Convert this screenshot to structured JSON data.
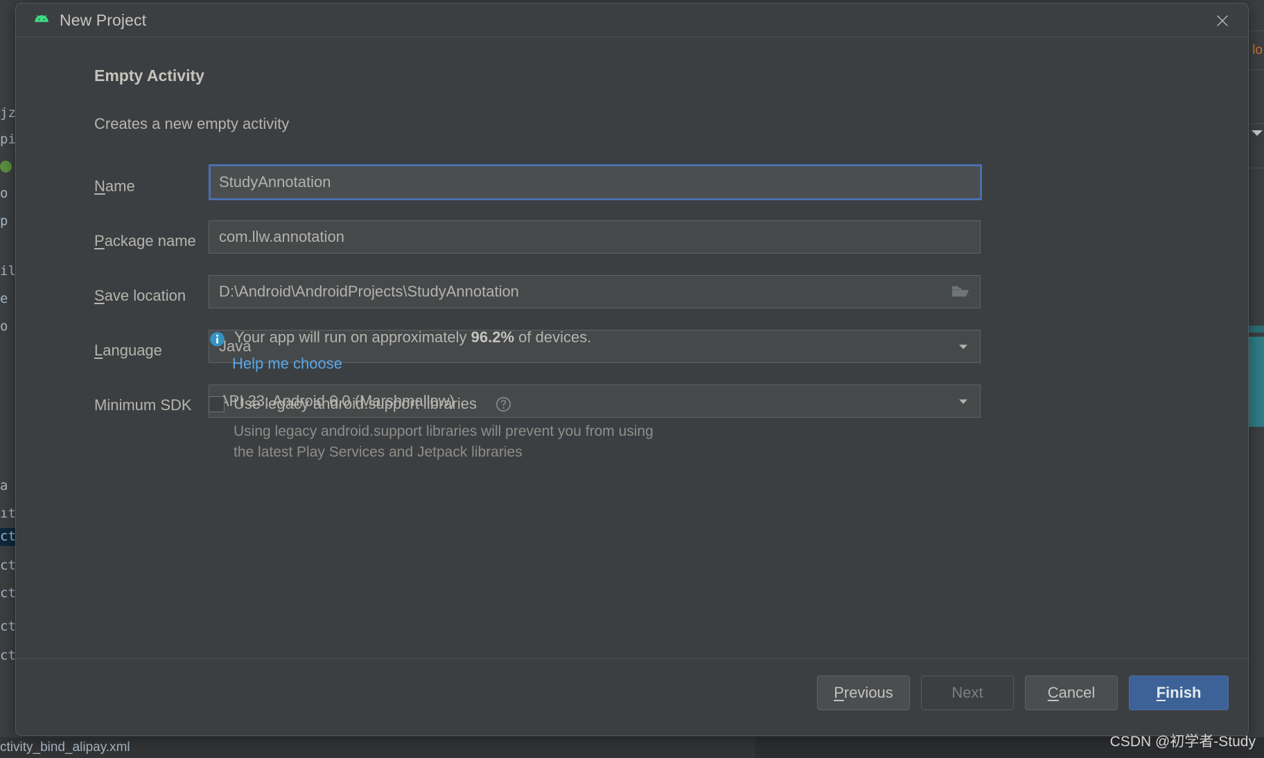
{
  "window": {
    "title": "New Project",
    "app_icon": "android-robot-icon",
    "close_icon": "close-icon"
  },
  "dialog": {
    "heading": "Empty Activity",
    "subheading": "Creates a new empty activity",
    "fields": [
      {
        "label": "Name",
        "mnemonic": "N",
        "value": "StudyAnnotation",
        "type": "text",
        "focused": true
      },
      {
        "label": "Package name",
        "mnemonic": "P",
        "value": "com.llw.annotation",
        "type": "text",
        "focused": false
      },
      {
        "label": "Save location",
        "mnemonic": "S",
        "value": "D:\\Android\\AndroidProjects\\StudyAnnotation",
        "type": "path",
        "trailing_icon": "folder-icon",
        "focused": false
      },
      {
        "label": "Language",
        "mnemonic": "L",
        "value": "Java",
        "type": "dropdown",
        "trailing_icon": "chevron-down-icon",
        "focused": false
      },
      {
        "label": "Minimum SDK",
        "mnemonic": "",
        "value": "API 23: Android 6.0 (Marshmallow)",
        "type": "dropdown",
        "trailing_icon": "chevron-down-icon",
        "focused": false
      }
    ],
    "info": {
      "icon": "info-icon",
      "text_before": "Your app will run on approximately",
      "highlight": "96.2%",
      "text_after": "of devices.",
      "link": "Help me choose"
    },
    "legacy_checkbox": {
      "checked": false,
      "label": "Use legacy android.support libraries",
      "help_icon": "question-mark-icon",
      "description_line1": "Using legacy android.support libraries will prevent you from using",
      "description_line2": "the latest Play Services and Jetpack libraries"
    }
  },
  "footer": {
    "buttons": [
      {
        "label": "Previous",
        "mnemonic": "P",
        "state": "enabled",
        "style": "default"
      },
      {
        "label": "Next",
        "mnemonic": "",
        "state": "disabled",
        "style": "default"
      },
      {
        "label": "Cancel",
        "mnemonic": "C",
        "state": "enabled",
        "style": "default"
      },
      {
        "label": "Finish",
        "mnemonic": "F",
        "state": "enabled",
        "style": "primary"
      }
    ]
  },
  "background": {
    "left_fragments": [
      "jz",
      "pi",
      "o",
      "p",
      "il",
      "e",
      "o",
      "a",
      "ıt",
      "ct",
      "ct",
      "ct",
      "ct",
      "ct"
    ],
    "bottom_tab_text": "ctivity_bind_alipay.xml",
    "right_fragment": "lo"
  },
  "watermark": "CSDN @初学者-Study",
  "colors": {
    "accent_blue": "#4b6eaf",
    "link_blue": "#5aa7e8",
    "android_green": "#3ddc84",
    "dialog_bg": "#3c3f41",
    "field_bg": "#45494a"
  }
}
